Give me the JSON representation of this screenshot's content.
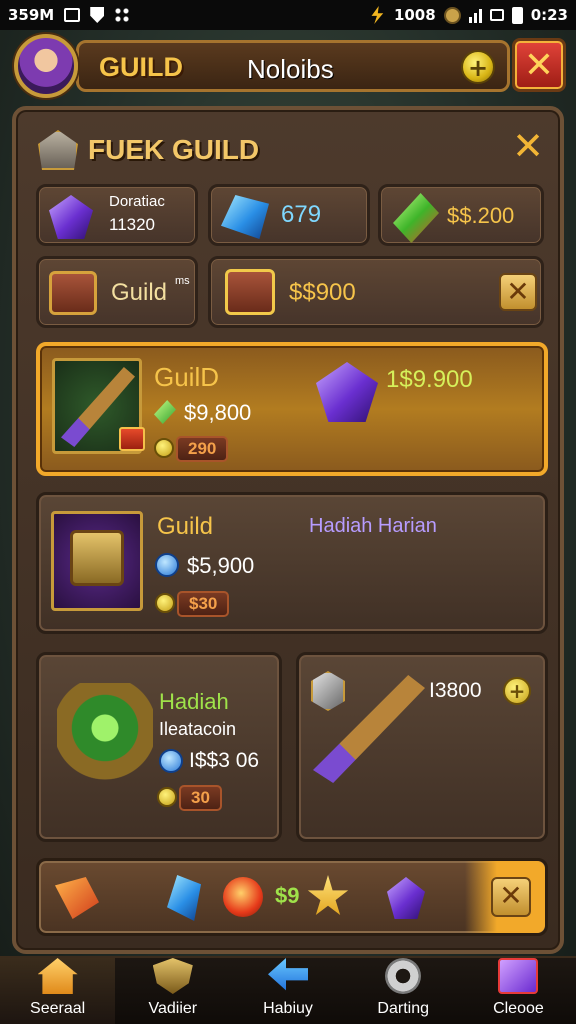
{
  "status_bar": {
    "left_text": "359M",
    "battery_text": "1008",
    "time": "0:23"
  },
  "header": {
    "title": "GUILD",
    "player_name": "Noloibs"
  },
  "panel": {
    "title": "FUEK GUILD",
    "resources": [
      {
        "name": "Doratiac",
        "value": "11320",
        "icon": "purple-gem-icon"
      },
      {
        "value": "679",
        "icon": "blue-crystal-icon"
      },
      {
        "value": "$$.200",
        "icon": "green-gem-icon"
      }
    ],
    "guild_bank": {
      "label": "Guild",
      "superscript": "ms",
      "value": "$$900"
    },
    "cards": [
      {
        "title": "GuilD",
        "price": "$9,800",
        "badge_value": "290",
        "reward_value": "1$9.900",
        "variant": "gold"
      },
      {
        "title": "Guild",
        "subtitle": "Hadiah Harian",
        "price": "$5,900",
        "badge_value": "$30",
        "variant": "dark"
      },
      {
        "title": "Hadiah",
        "subtitle": "Ileatacoin",
        "price": "I$$3 06",
        "badge_value": "30",
        "variant": "dark"
      },
      {
        "value": "I3800",
        "variant": "dark"
      }
    ],
    "strip": {
      "value": "$9"
    }
  },
  "nav": [
    {
      "label": "Seeraal",
      "icon": "home-icon",
      "active": true
    },
    {
      "label": "Vadiier",
      "icon": "shield-icon",
      "active": false
    },
    {
      "label": "Habiuy",
      "icon": "arrow-icon",
      "active": false
    },
    {
      "label": "Darting",
      "icon": "gear-icon",
      "active": false
    },
    {
      "label": "Cleooe",
      "icon": "chest-icon",
      "active": false
    }
  ]
}
